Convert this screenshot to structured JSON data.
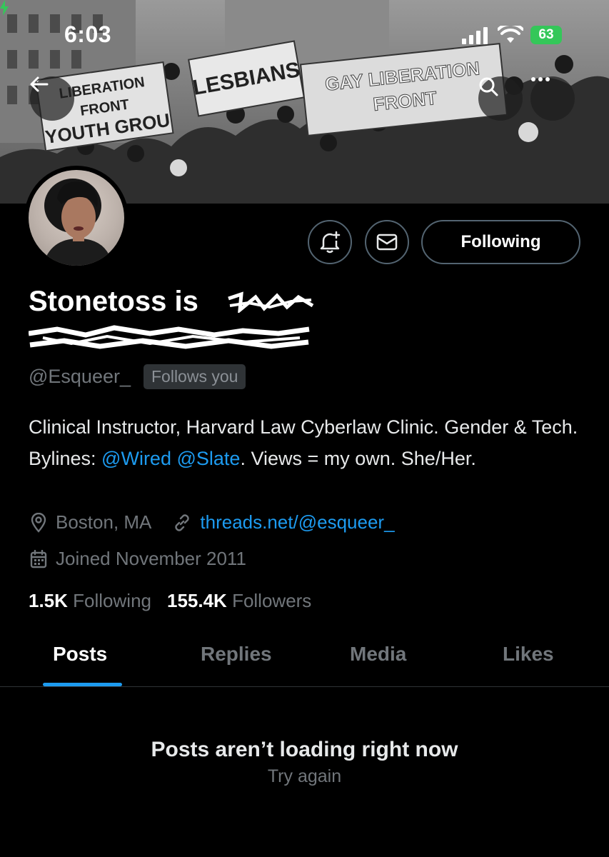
{
  "status_bar": {
    "time": "6:03",
    "battery": "63"
  },
  "profile": {
    "name": "Stonetoss is",
    "handle": "@Esqueer_",
    "follows_you": "Follows you",
    "bio": {
      "line_start": "Clinical Instructor, Harvard Law Cyberlaw Clinic. Gender & Tech. Bylines: ",
      "mention_1": "@Wired",
      "mention_2": "@Slate",
      "line_end": ". Views = my own. She/Her."
    },
    "location": "Boston, MA",
    "website": "threads.net/@esqueer_",
    "joined": "Joined November 2011",
    "following_count": "1.5K",
    "following_label": "Following",
    "followers_count": "155.4K",
    "followers_label": "Followers"
  },
  "actions": {
    "following_button": "Following"
  },
  "banner": {
    "signs": [
      "LIBERATION FRONT YOUTH GROUP",
      "LESBIANS",
      "GAY LIBERATION FRONT"
    ]
  },
  "tabs": [
    "Posts",
    "Replies",
    "Media",
    "Likes"
  ],
  "active_tab": "Posts",
  "feed": {
    "error_title": "Posts aren’t loading right now",
    "retry_label": "Try again"
  },
  "colors": {
    "accent": "#1d9bf0",
    "muted": "#71767b",
    "battery": "#34c759"
  }
}
